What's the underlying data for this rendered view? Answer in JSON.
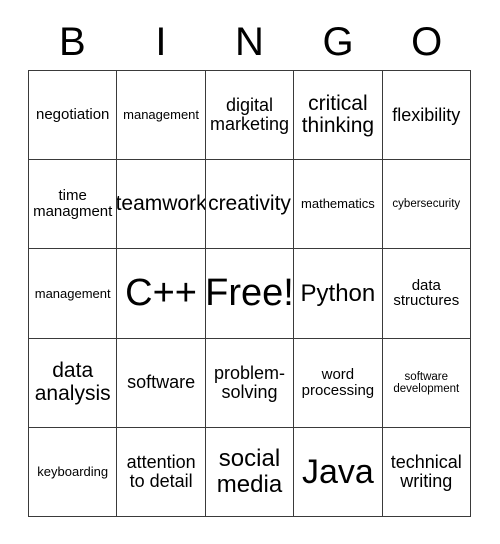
{
  "card": {
    "title": "BINGO",
    "header_letters": [
      "B",
      "I",
      "N",
      "G",
      "O"
    ],
    "free_space_label": "Free!",
    "grid": {
      "rows": 5,
      "columns": 5,
      "border_color": "#3a3a3a",
      "background_color": "#ffffff",
      "text_color": "#000000"
    },
    "cells": [
      {
        "row": 1,
        "col": 1,
        "column_letter": "B",
        "text": "negotiation",
        "size": "fs-md"
      },
      {
        "row": 1,
        "col": 2,
        "column_letter": "I",
        "text": "management",
        "size": "fs-sm"
      },
      {
        "row": 1,
        "col": 3,
        "column_letter": "N",
        "text": "digital\nmarketing",
        "size": "fs-lg"
      },
      {
        "row": 1,
        "col": 4,
        "column_letter": "G",
        "text": "critical\nthinking",
        "size": "fs-xl"
      },
      {
        "row": 1,
        "col": 5,
        "column_letter": "O",
        "text": "flexibility",
        "size": "fs-lg"
      },
      {
        "row": 2,
        "col": 1,
        "column_letter": "B",
        "text": "time\nmanagment",
        "size": "fs-md"
      },
      {
        "row": 2,
        "col": 2,
        "column_letter": "I",
        "text": "teamwork",
        "size": "fs-xl"
      },
      {
        "row": 2,
        "col": 3,
        "column_letter": "N",
        "text": "creativity",
        "size": "fs-xl"
      },
      {
        "row": 2,
        "col": 4,
        "column_letter": "G",
        "text": "mathematics",
        "size": "fs-sm"
      },
      {
        "row": 2,
        "col": 5,
        "column_letter": "O",
        "text": "cybersecurity",
        "size": "fs-xs"
      },
      {
        "row": 3,
        "col": 1,
        "column_letter": "B",
        "text": "management",
        "size": "fs-sm"
      },
      {
        "row": 3,
        "col": 2,
        "column_letter": "I",
        "text": "C++",
        "size": "fs-4xl"
      },
      {
        "row": 3,
        "col": 3,
        "column_letter": "N",
        "text": "Free!",
        "size": "fs-4xl"
      },
      {
        "row": 3,
        "col": 4,
        "column_letter": "G",
        "text": "Python",
        "size": "fs-2xl"
      },
      {
        "row": 3,
        "col": 5,
        "column_letter": "O",
        "text": "data\nstructures",
        "size": "fs-md"
      },
      {
        "row": 4,
        "col": 1,
        "column_letter": "B",
        "text": "data\nanalysis",
        "size": "fs-xl"
      },
      {
        "row": 4,
        "col": 2,
        "column_letter": "I",
        "text": "software",
        "size": "fs-lg"
      },
      {
        "row": 4,
        "col": 3,
        "column_letter": "N",
        "text": "problem-\nsolving",
        "size": "fs-lg"
      },
      {
        "row": 4,
        "col": 4,
        "column_letter": "G",
        "text": "word\nprocessing",
        "size": "fs-md"
      },
      {
        "row": 4,
        "col": 5,
        "column_letter": "O",
        "text": "software\ndevelopment",
        "size": "fs-xs"
      },
      {
        "row": 5,
        "col": 1,
        "column_letter": "B",
        "text": "keyboarding",
        "size": "fs-sm"
      },
      {
        "row": 5,
        "col": 2,
        "column_letter": "I",
        "text": "attention\nto detail",
        "size": "fs-lg"
      },
      {
        "row": 5,
        "col": 3,
        "column_letter": "N",
        "text": "social\nmedia",
        "size": "fs-2xl"
      },
      {
        "row": 5,
        "col": 4,
        "column_letter": "G",
        "text": "Java",
        "size": "fs-3xl"
      },
      {
        "row": 5,
        "col": 5,
        "column_letter": "O",
        "text": "technical\nwriting",
        "size": "fs-lg"
      }
    ]
  }
}
